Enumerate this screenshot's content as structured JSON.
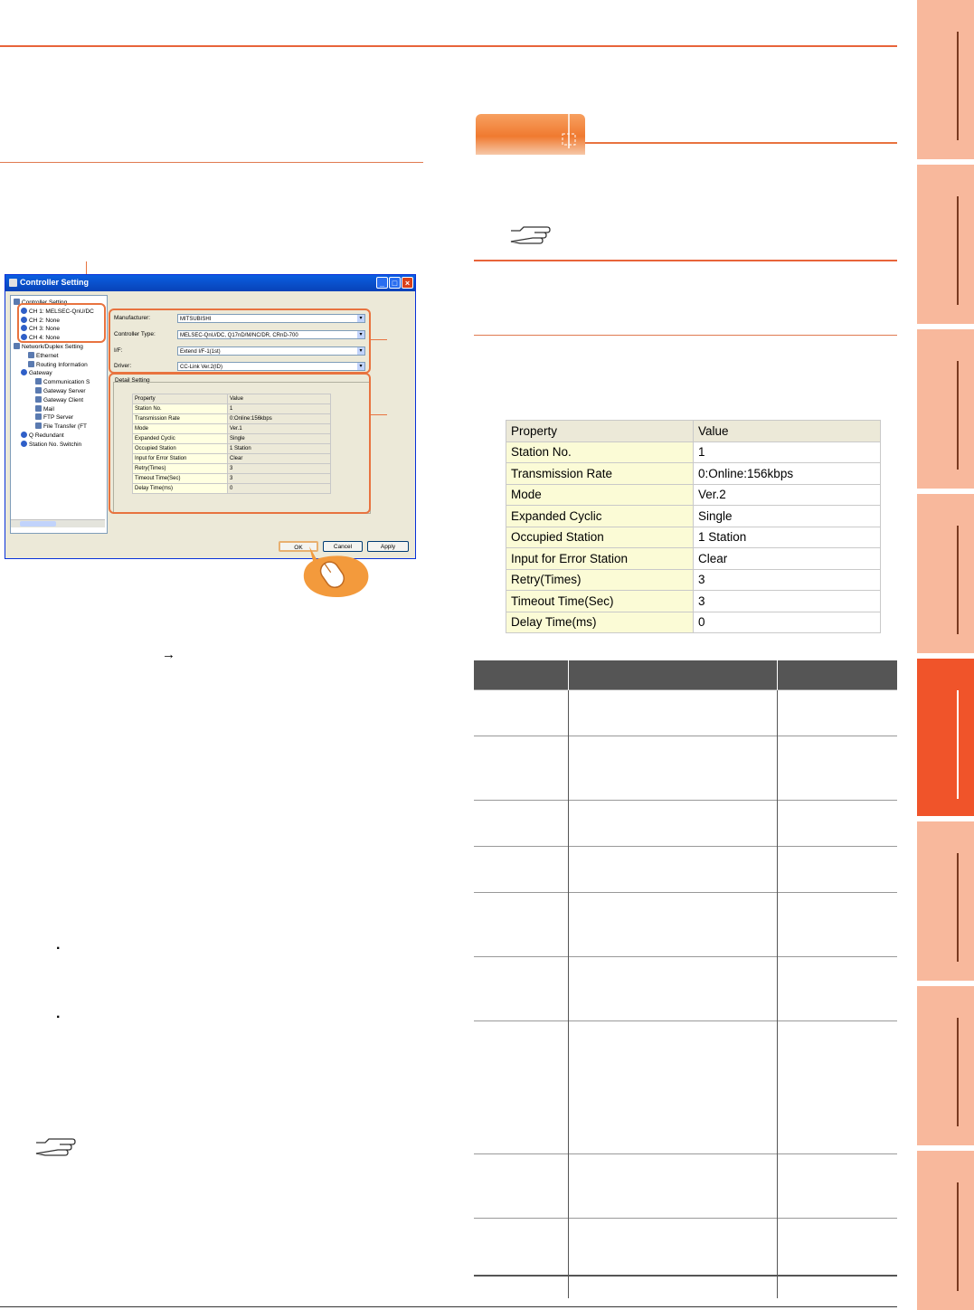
{
  "colors": {
    "accent": "#e8643a",
    "active_tab": "#f0542a",
    "tab": "#f8b89c"
  },
  "dialog": {
    "title": "Controller Setting",
    "tree": [
      {
        "label": "Controller Setting",
        "level": 0
      },
      {
        "label": "CH 1: MELSEC-QnU/DC",
        "level": 1
      },
      {
        "label": "CH 2: None",
        "level": 1
      },
      {
        "label": "CH 3: None",
        "level": 1
      },
      {
        "label": "CH 4: None",
        "level": 1
      },
      {
        "label": "Network/Duplex Setting",
        "level": 0
      },
      {
        "label": "Ethernet",
        "level": 2
      },
      {
        "label": "Routing Information",
        "level": 2
      },
      {
        "label": "Gateway",
        "level": 1
      },
      {
        "label": "Communication S",
        "level": 3
      },
      {
        "label": "Gateway Server",
        "level": 3
      },
      {
        "label": "Gateway Client",
        "level": 3
      },
      {
        "label": "Mail",
        "level": 3
      },
      {
        "label": "FTP Server",
        "level": 3
      },
      {
        "label": "File Transfer (FT",
        "level": 3
      },
      {
        "label": "Q Redundant",
        "level": 1
      },
      {
        "label": "Station No. Switchin",
        "level": 1
      }
    ],
    "fields": {
      "manufacturer_label": "Manufacturer:",
      "manufacturer_value": "MITSUBISHI",
      "controller_type_label": "Controller Type:",
      "controller_type_value": "MELSEC-QnU/DC, Q17nD/M/NC/DR, CRnD-700",
      "if_label": "I/F:",
      "if_value": "Extend I/F-1(1st)",
      "driver_label": "Driver:",
      "driver_value": "CC-Link Ver.2(ID)"
    },
    "detail_label": "Detail Setting",
    "mini_table": {
      "headers": [
        "Property",
        "Value"
      ],
      "rows": [
        [
          "Station No.",
          "1"
        ],
        [
          "Transmission Rate",
          "0:Online:156kbps"
        ],
        [
          "Mode",
          "Ver.1"
        ],
        [
          "Expanded Cyclic",
          "Single"
        ],
        [
          "Occupied Station",
          "1 Station"
        ],
        [
          "Input for Error Station",
          "Clear"
        ],
        [
          "Retry(Times)",
          "3"
        ],
        [
          "Timeout Time(Sec)",
          "3"
        ],
        [
          "Delay Time(ms)",
          "0"
        ]
      ]
    },
    "buttons": {
      "ok": "OK",
      "cancel": "Cancel",
      "apply": "Apply"
    }
  },
  "left_arrow": "→",
  "bullets": [
    "·",
    "·"
  ],
  "property_table": {
    "headers": [
      "Property",
      "Value"
    ],
    "rows": [
      [
        "Station No.",
        "1"
      ],
      [
        "Transmission Rate",
        "0:Online:156kbps"
      ],
      [
        "Mode",
        "Ver.2"
      ],
      [
        "Expanded Cyclic",
        "Single"
      ],
      [
        "Occupied Station",
        "1 Station"
      ],
      [
        "Input for Error Station",
        "Clear"
      ],
      [
        "Retry(Times)",
        "3"
      ],
      [
        "Timeout Time(Sec)",
        "3"
      ],
      [
        "Delay Time(ms)",
        "0"
      ]
    ]
  }
}
